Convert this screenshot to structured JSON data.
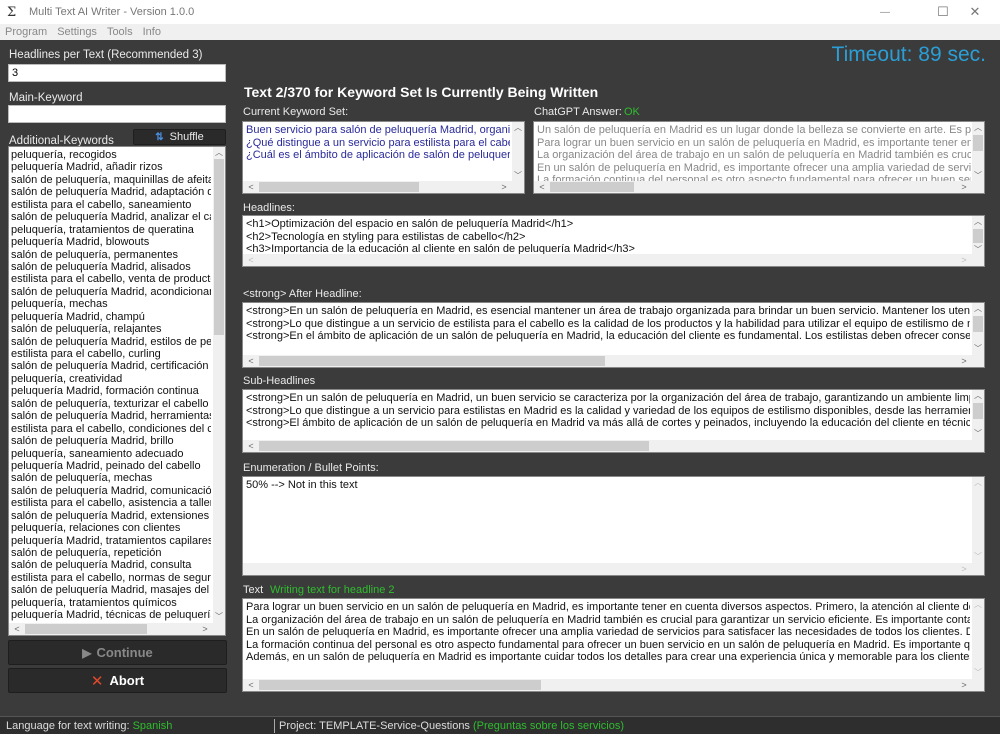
{
  "window": {
    "title": "Multi Text AI Writer - Version 1.0.0",
    "app_icon": "Σ",
    "controls": {
      "minimize": "—",
      "maximize": "☐",
      "close": "✕"
    }
  },
  "menu": [
    "Program",
    "Settings",
    "Tools",
    "Info"
  ],
  "left": {
    "headlines_label": "Headlines per Text (Recommended 3)",
    "headlines_value": "3",
    "main_keyword_label": "Main-Keyword",
    "main_keyword_value": "",
    "additional_keywords_label": "Additional-Keywords",
    "shuffle_label": "Shuffle",
    "keywords": [
      "peluquería, recogidos",
      "peluquería Madrid, añadir rizos",
      "salón de peluquería, maquinillas de afeitar",
      "salón de peluquería Madrid, adaptación de",
      "estilista para el cabello, saneamiento",
      "salón de peluquería Madrid, analizar el cab",
      "peluquería, tratamientos de queratina",
      "peluquería Madrid, blowouts",
      "salón de peluquería, permanentes",
      "salón de peluquería Madrid, alisados",
      "estilista para el cabello, venta de productos",
      "salón de peluquería Madrid, acondicionam",
      "peluquería, mechas",
      "peluquería Madrid, champú",
      "salón de peluquería, relajantes",
      "salón de peluquería Madrid, estilos de pelu",
      "estilista para el cabello, curling",
      "salón de peluquería Madrid, certificación",
      "peluquería, creatividad",
      "peluquería Madrid, formación continua",
      "salón de peluquería, texturizar el cabello",
      "salón de peluquería Madrid, herramientas c",
      "estilista para el cabello, condiciones del cu",
      "salón de peluquería Madrid, brillo",
      "peluquería, saneamiento adecuado",
      "peluquería Madrid, peinado del cabello",
      "salón de peluquería, mechas",
      "salón de peluquería Madrid, comunicación",
      "estilista para el cabello, asistencia a tallere",
      "salón de peluquería Madrid, extensiones de",
      "peluquería, relaciones con clientes",
      "peluquería Madrid, tratamientos capilares",
      "salón de peluquería, repetición",
      "salón de peluquería Madrid, consulta",
      "estilista para el cabello, normas de segurid",
      "salón de peluquería Madrid, masajes del cu",
      "peluquería, tratamientos químicos",
      "peluquería Madrid, técnicas de peluquería"
    ],
    "continue_label": "Continue",
    "abort_label": "Abort"
  },
  "header": {
    "timeout": "Timeout: 89 sec.",
    "progress_title": "Text 2/370 for Keyword Set Is Currently Being Written"
  },
  "current_keyword_set": {
    "label": "Current Keyword Set:",
    "lines": [
      "Buen servicio para salón de peluquería Madrid, organizac",
      "¿Qué distingue a un servicio para estilista para el cabello",
      "¿Cuál es el ámbito de aplicación de salón de peluquería I"
    ]
  },
  "chatgpt_answer": {
    "label": "ChatGPT Answer:",
    "status": "OK",
    "lines": [
      "Un salón de peluquería en Madrid es un lugar donde la belleza se convierte en arte. Es por es",
      "Para lograr un buen servicio en un salón de peluquería en Madrid, es importante tener en cuen",
      "La organización del área de trabajo en un salón de peluquería en Madrid también es crucial pa",
      "En un salón de peluquería en Madrid, es importante ofrecer una amplia variedad de servicios",
      "La formación continua del personal es otro aspecto fundamental para ofrecer un buen servicio"
    ]
  },
  "headlines": {
    "label": "Headlines:",
    "lines": [
      "<h1>Optimización del espacio en salón de peluquería Madrid</h1>",
      "<h2>Tecnología en styling para estilistas de cabello</h2>",
      "<h3>Importancia de la educación al cliente en salón de peluquería Madrid</h3>"
    ]
  },
  "after_headline": {
    "label": "<strong> After Headline:",
    "lines": [
      "<strong>En un salón de peluquería en Madrid, es esencial mantener un área de trabajo organizada para brindar un buen servicio. Mantener los utensilios limp",
      "<strong>Lo que distingue a un servicio de estilista para el cabello es la calidad de los productos y la habilidad para utilizar el equipo de estilismo de manera",
      "<strong>En el ámbito de aplicación de un salón de peluquería en Madrid, la educación del cliente es fundamental. Los estilistas deben ofrecer consejos sobr"
    ]
  },
  "sub_headlines": {
    "label": "Sub-Headlines",
    "lines": [
      "<strong>En un salón de peluquería en Madrid, un buen servicio se caracteriza por la organización del área de trabajo, garantizando un ambiente limpio y orde",
      "<strong>Lo que distingue a un servicio para estilistas en Madrid es la calidad y variedad de los equipos de estilismo disponibles, desde las herramientas bá",
      "<strong>El ámbito de aplicación de un salón de peluquería en Madrid va más allá de cortes y peinados, incluyendo la educación del cliente en técnicas de c"
    ]
  },
  "enumeration": {
    "label": "Enumeration / Bullet Points:",
    "lines": [
      "50% --> Not in this text"
    ]
  },
  "text": {
    "label": "Text",
    "status": "Writing text for headline 2",
    "lines": [
      "Para lograr un buen servicio en un salón de peluquería en Madrid, es importante tener en cuenta diversos aspectos. Primero, la atención al cliente debe ser ir",
      "La organización del área de trabajo en un salón de peluquería en Madrid también es crucial para garantizar un servicio eficiente. Es importante contar con un",
      "En un salón de peluquería en Madrid, es importante ofrecer una amplia variedad de servicios para satisfacer las necesidades de todos los clientes. Desde c",
      "La formación continua del personal es otro aspecto fundamental para ofrecer un buen servicio en un salón de peluquería en Madrid. Es importante que los pr",
      "Además, en un salón de peluquería en Madrid es importante cuidar todos los detalles para crear una experiencia única y memorable para los clientes. Desd"
    ]
  },
  "status": {
    "language_label": "Language for text writing:",
    "language_value": "Spanish",
    "project_label": "Project: TEMPLATE-Service-Questions",
    "project_value": "(Preguntas sobre los servicios)"
  },
  "colors": {
    "accent_timeout": "#2a9fd6",
    "status_green": "#2ebd2e",
    "keyword_set_text": "#2a2a9a",
    "abort_icon": "#e04a2a"
  }
}
